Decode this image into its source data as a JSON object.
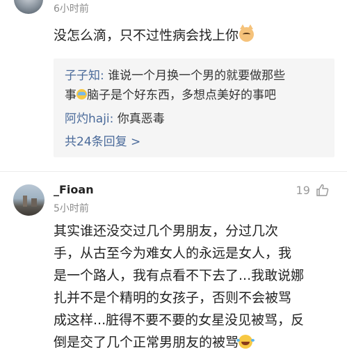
{
  "top_comment": {
    "time": "6小时前",
    "text": "没怎么滴，只不过性病会找上你",
    "emoji": "cat-face-icon"
  },
  "replies": {
    "reply1_name": "子子知:",
    "reply1_text_a": "谁说一个月换一个男的就要做那些",
    "reply1_text_b_pre": "事",
    "reply1_text_b_post": "脑子是个好东西，多想点美好的事吧",
    "reply2_name": "阿灼haji:",
    "reply2_text": "你真恶毒",
    "more_label": "共24条回复 >"
  },
  "comment": {
    "username": "_Fioan",
    "time": "5小时前",
    "likes": "19",
    "lines": [
      "其实谁还没交过几个男朋友，分过几次",
      "手，从古至今为难女人的永远是女人，我",
      "是一个路人，我有点看不下去了...我敢说娜",
      "扎并不是个精明的女孩子，否则不会被骂",
      "成这样...脏得不要不要的女星没见被骂，反",
      "倒是交了几个正常男朋友的被骂"
    ],
    "end_emoji": "laughing-tears-icon"
  },
  "colors": {
    "link": "#4a6a9a",
    "muted": "#8c8c8c",
    "reply_bg": "#f5f5f5"
  }
}
